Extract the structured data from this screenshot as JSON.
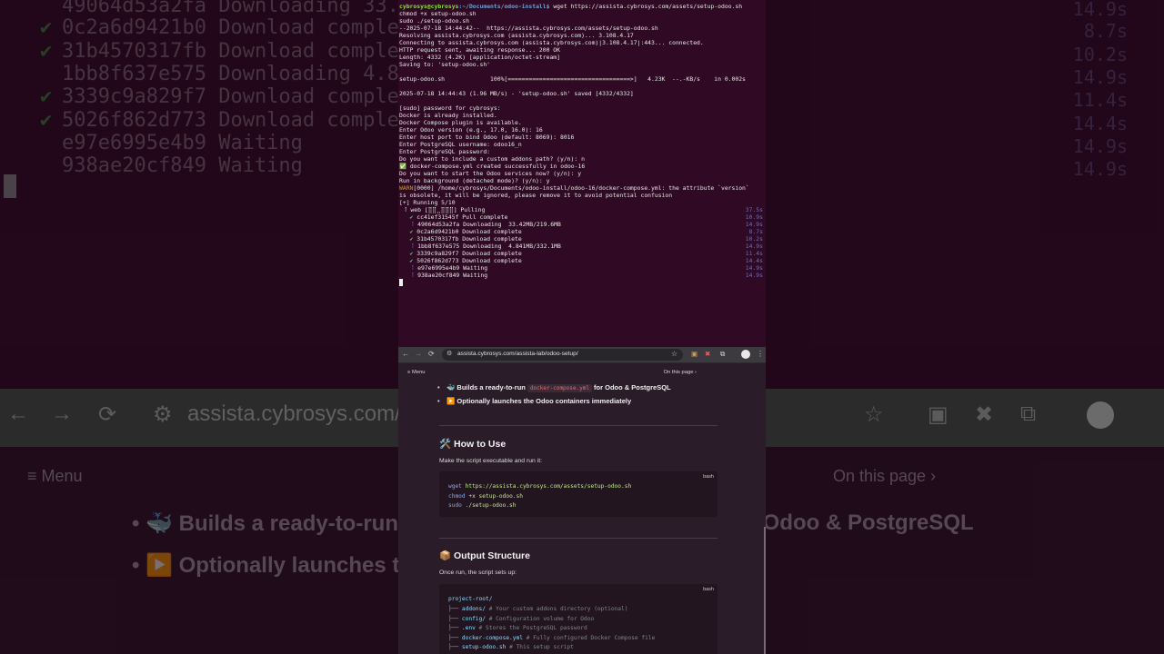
{
  "terminal": {
    "prompt_user": "cybrosys@cybrosys",
    "prompt_path": ":~/Documents/odoo-install$",
    "prompt_cmd": " wget https://assista.cybrosys.com/assets/setup-odoo.sh",
    "lines": [
      "chmod +x setup-odoo.sh",
      "sudo ./setup-odoo.sh",
      "--2025-07-18 14:44:42--  https://assista.cybrosys.com/assets/setup-odoo.sh",
      "Resolving assista.cybrosys.com (assista.cybrosys.com)... 3.108.4.17",
      "Connecting to assista.cybrosys.com (assista.cybrosys.com)|3.108.4.17|:443... connected.",
      "HTTP request sent, awaiting response... 200 OK",
      "Length: 4332 (4.2K) [application/octet-stream]",
      "Saving to: 'setup-odoo.sh'",
      "",
      "setup-odoo.sh             100%[===================================>]   4.23K  --.-KB/s    in 0.002s",
      "",
      "2025-07-18 14:44:43 (1.96 MB/s) - 'setup-odoo.sh' saved [4332/4332]",
      "",
      "[sudo] password for cybrosys:",
      "Docker is already installed.",
      "Docker Compose plugin is available.",
      "Enter Odoo version (e.g., 17.0, 16.0): 16",
      "Enter host port to bind Odoo (default: 8069): 8016",
      "Enter PostgreSQL username: odoo16_n",
      "Enter PostgreSQL password:",
      "Do you want to include a custom addons path? (y/n): n"
    ],
    "success_icon": "✅",
    "success_line": " docker-compose.yml created successfully in odoo-16",
    "lines2": [
      "Do you want to start the Odoo services now? (y/n): y",
      "Run in background (detached mode)? (y/n): y"
    ],
    "warn_tag": "WARN",
    "warn_line": "[0000] /home/cybrosys/Documents/odoo-install/odoo-16/docker-compose.yml: the attribute `version`",
    "warn_line2": "is obsolete, it will be ignored, please remove it to avoid potential confusion",
    "running": "[+] Running 5/10",
    "web_line": " ⠸ web [⣿⣿⣀⣿⣿⣿] Pulling",
    "web_time": "37.5s",
    "layers": [
      {
        "mark": "✔",
        "id": "cc41ef31545f",
        "status": "Pull complete",
        "time": "10.9s"
      },
      {
        "mark": "⠸",
        "id": "49064d53a2fa",
        "status": "Downloading  33.42MB/219.6MB",
        "time": "14.9s"
      },
      {
        "mark": "✔",
        "id": "0c2a6d9421b0",
        "status": "Download complete",
        "time": "8.7s"
      },
      {
        "mark": "✔",
        "id": "31b4570317fb",
        "status": "Download complete",
        "time": "10.2s"
      },
      {
        "mark": "⠸",
        "id": "1bb8f637e575",
        "status": "Downloading  4.841MB/332.1MB",
        "time": "14.9s"
      },
      {
        "mark": "✔",
        "id": "3339c9a829f7",
        "status": "Download complete",
        "time": "11.4s"
      },
      {
        "mark": "✔",
        "id": "5026f862d773",
        "status": "Download complete",
        "time": "14.4s"
      },
      {
        "mark": "⠸",
        "id": "e97e6995e4b9",
        "status": "Waiting",
        "time": "14.9s"
      },
      {
        "mark": "⠸",
        "id": "938ae20cf849",
        "status": "Waiting",
        "time": "14.9s"
      }
    ]
  },
  "browser": {
    "back": "←",
    "forward": "→",
    "reload": "⟳",
    "tune_icon": "⚙",
    "url": "assista.cybrosys.com/assista-lab/odoo-setup/",
    "star": "☆",
    "ext1": "▣",
    "ext2": "✖",
    "ext3": "⧉",
    "kebab": "⋮"
  },
  "page": {
    "menu_icon": "≡",
    "menu_label": "Menu",
    "on_this_page": "On this page ›",
    "bullets": [
      {
        "emoji": "🐳",
        "pre": " Builds a ready-to-run ",
        "code": "docker-compose.yml",
        "post": " for Odoo & PostgreSQL"
      },
      {
        "emoji": "▶️",
        "pre": " Optionally launches the Odoo containers immediately",
        "code": "",
        "post": ""
      }
    ],
    "how_to_use": {
      "title": "🛠️ How to Use",
      "desc": "Make the script executable and run it:",
      "lang": "bash",
      "lines": [
        {
          "cmd": "wget",
          "rest": " https://assista.cybrosys.com/assets/setup-odoo.sh"
        },
        {
          "cmd": "chmod",
          "rest": " +x setup-odoo.sh"
        },
        {
          "cmd": "sudo",
          "rest": " ./setup-odoo.sh"
        }
      ]
    },
    "output_structure": {
      "title": "📦 Output Structure",
      "desc": "Once run, the script sets up:",
      "lang": "bash",
      "root": "project-root/",
      "items": [
        {
          "tree": "├── ",
          "name": "addons/",
          "comment": " # Your custom addons directory (optional)"
        },
        {
          "tree": "├── ",
          "name": "config/",
          "comment": " # Configuration volume for Odoo"
        },
        {
          "tree": "├── ",
          "name": ".env",
          "comment": " # Stores the PostgreSQL password"
        },
        {
          "tree": "├── ",
          "name": "docker-compose.yml",
          "comment": " # Fully configured Docker Compose file"
        },
        {
          "tree": "├── ",
          "name": "setup-odoo.sh",
          "comment": " # This setup script"
        }
      ]
    }
  }
}
